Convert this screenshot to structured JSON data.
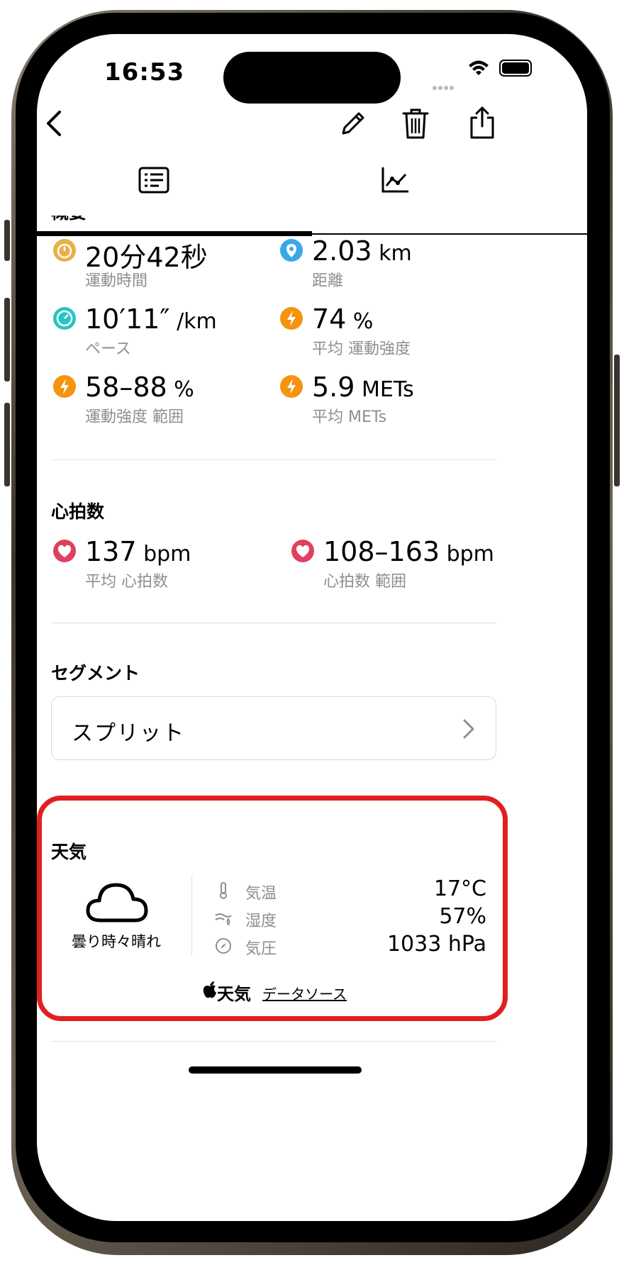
{
  "status_bar": {
    "time": "16:53"
  },
  "nav": {
    "back_icon": "chevron-left-icon",
    "edit_icon": "pencil-icon",
    "delete_icon": "trash-icon",
    "share_icon": "share-icon"
  },
  "tabs": [
    {
      "icon": "list-icon",
      "selected": true
    },
    {
      "icon": "chart-icon",
      "selected": false
    }
  ],
  "summary": {
    "title": "概要",
    "stats": [
      {
        "value": "20分42秒",
        "unit": "",
        "label": "運動時間",
        "icon": "stopwatch-icon",
        "color": "#e8b04a"
      },
      {
        "value": "2.03",
        "unit": "km",
        "label": "距離",
        "icon": "location-pin-icon",
        "color": "#3aa7e8"
      },
      {
        "value": "10′11″",
        "unit": "/km",
        "label": "ペース",
        "icon": "speedometer-icon",
        "color": "#27c4c4"
      },
      {
        "value": "74",
        "unit": "%",
        "label": "平均 運動強度",
        "icon": "bolt-icon",
        "color": "#f5940f"
      },
      {
        "value": "58–88",
        "unit": "%",
        "label": "運動強度 範囲",
        "icon": "bolt-icon",
        "color": "#f5940f"
      },
      {
        "value": "5.9",
        "unit": "METs",
        "label": "平均 METs",
        "icon": "bolt-icon",
        "color": "#f5940f"
      }
    ]
  },
  "heart_rate": {
    "title": "心拍数",
    "stats": [
      {
        "value": "137",
        "unit": "bpm",
        "label": "平均 心拍数",
        "icon": "heart-icon",
        "color": "#e0405e"
      },
      {
        "value": "108–163",
        "unit": "bpm",
        "label": "心拍数 範囲",
        "icon": "heart-icon",
        "color": "#e0405e"
      }
    ]
  },
  "segments": {
    "title": "セグメント",
    "split_label": "スプリット"
  },
  "weather": {
    "title": "天気",
    "condition": "曇り時々晴れ",
    "rows": [
      {
        "icon": "thermometer-icon",
        "label": "気温",
        "value": "17°C"
      },
      {
        "icon": "wind-icon",
        "label": "湿度",
        "value": "57%"
      },
      {
        "icon": "compass-icon",
        "label": "気圧",
        "value": "1033 hPa"
      }
    ],
    "attribution": "天気",
    "data_source_link": "データソース"
  }
}
